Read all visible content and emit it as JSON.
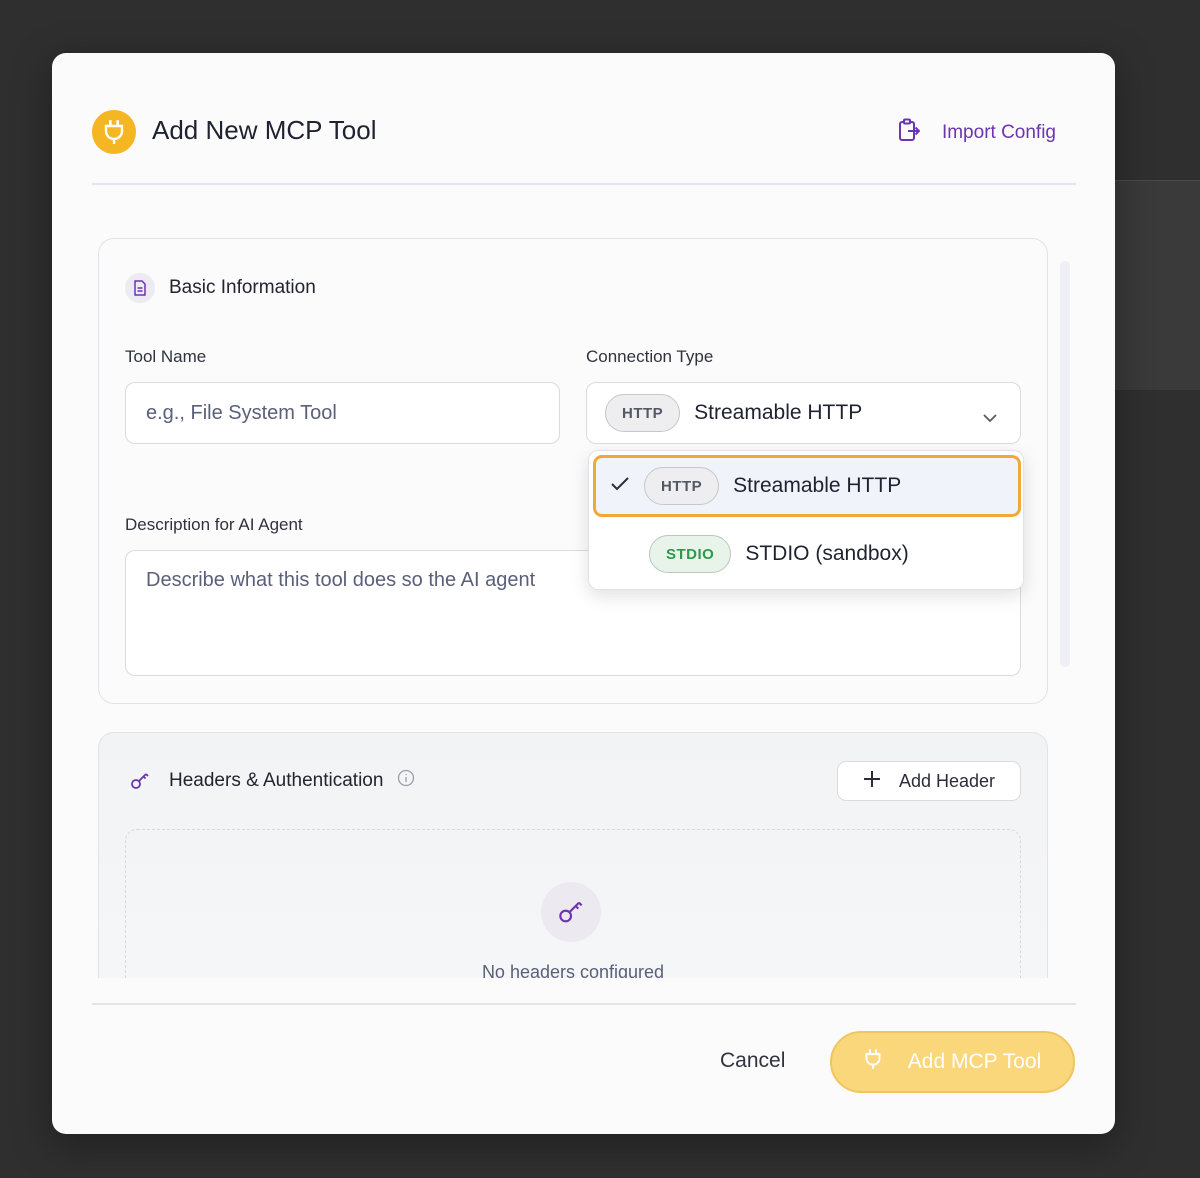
{
  "modal": {
    "title": "Add New MCP Tool",
    "import_label": "Import Config"
  },
  "basic": {
    "section_title": "Basic Information",
    "tool_name_label": "Tool Name",
    "tool_name_placeholder": "e.g., File System Tool",
    "connection_label": "Connection Type",
    "connection_selected_badge": "HTTP",
    "connection_selected": "Streamable HTTP",
    "description_label": "Description for AI Agent",
    "description_placeholder": "Describe what this tool does so the AI agent"
  },
  "dropdown": {
    "options": [
      {
        "badge": "HTTP",
        "label": "Streamable HTTP",
        "selected": true
      },
      {
        "badge": "STDIO",
        "label": "STDIO (sandbox)",
        "selected": false
      }
    ]
  },
  "headers": {
    "section_title": "Headers & Authentication",
    "add_label": "Add Header",
    "empty_text": "No headers configured"
  },
  "footer": {
    "cancel_label": "Cancel",
    "submit_label": "Add MCP Tool"
  },
  "colors": {
    "accent_yellow": "#f5b623",
    "accent_purple": "#6b35b0",
    "selected_border": "#f0a83a"
  }
}
